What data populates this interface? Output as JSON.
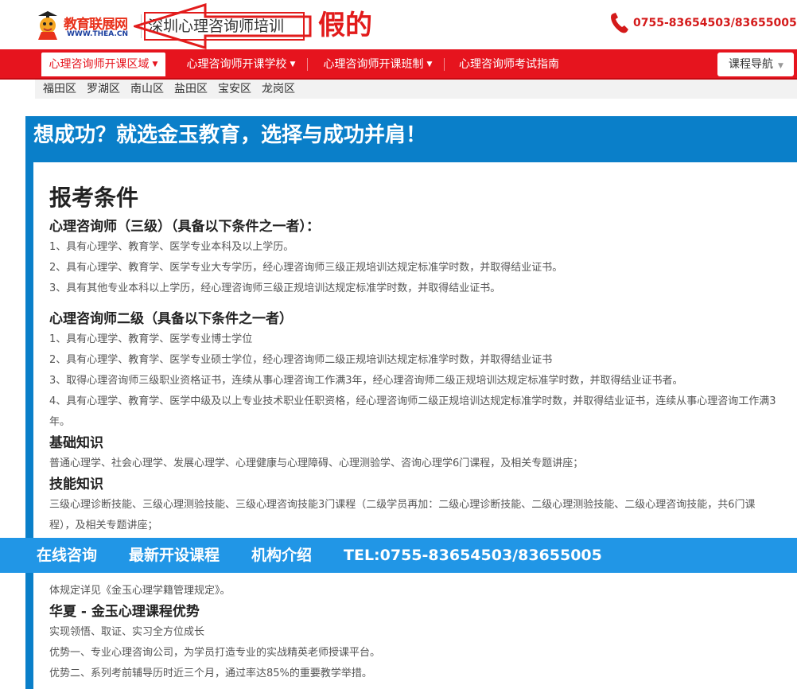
{
  "header": {
    "logo_text": "教育联展网",
    "logo_url": "WWW.THEA.CN",
    "site_title": "深圳心理咨询师培训",
    "annotation_fake": "假的",
    "phone": "0755-83654503/83655005"
  },
  "nav": {
    "items": [
      {
        "label": "心理咨询师开课区域"
      },
      {
        "label": "心理咨询师开课学校"
      },
      {
        "label": "心理咨询师开课班制"
      },
      {
        "label": "心理咨询师考试指南"
      }
    ],
    "course_nav": "课程导航"
  },
  "districts": [
    "福田区",
    "罗湖区",
    "南山区",
    "盐田区",
    "宝安区",
    "龙岗区"
  ],
  "banner": "想成功？就选金玉教育，选择与成功并肩！",
  "content": {
    "title": "报考条件",
    "level3_heading": "心理咨询师（三级）（具备以下条件之一者）：",
    "level3_items": [
      "1、具有心理学、教育学、医学专业本科及以上学历。",
      "2、具有心理学、教育学、医学专业大专学历，经心理咨询师三级正规培训达规定标准学时数，并取得结业证书。",
      "3、具有其他专业本科以上学历，经心理咨询师三级正规培训达规定标准学时数，并取得结业证书。"
    ],
    "level2_heading": "心理咨询师二级（具备以下条件之一者）",
    "level2_items": [
      "1、具有心理学、教育学、医学专业博士学位",
      "2、具有心理学、教育学、医学专业硕士学位，经心理咨询师二级正规培训达规定标准学时数，并取得结业证书",
      "3、取得心理咨询师三级职业资格证书，连续从事心理咨询工作满3年，经心理咨询师二级正规培训达规定标准学时数，并取得结业证书者。",
      "4、具有心理学、教育学、医学中级及以上专业技术职业任职资格，经心理咨询师二级正规培训达规定标准学时数，并取得结业证书，连续从事心理咨询工作满3年。"
    ],
    "basic_heading": "基础知识",
    "basic_text": "普通心理学、社会心理学、发展心理学、心理健康与心理障碍、心理测验学、咨询心理学6门课程，及相关专题讲座；",
    "skill_heading": "技能知识",
    "skill_text": "三级心理诊断技能、三级心理测验技能、三级心理咨询技能3门课程（二级学员再加：二级心理诊断技能、二级心理测验技能、二级心理咨询技能，共6门课程），及相关专题讲座；",
    "rules_text": "体规定详见《金玉心理学籍管理规定》。",
    "adv_heading": "华夏 - 金玉心理课程优势",
    "adv_items": [
      "实现领悟、取证、实习全方位成长",
      "优势一、专业心理咨询公司，为学员打造专业的实战精英老师授课平台。",
      "优势二、系列考前辅导历时近三个月，通过率达85%的重要教学举措。"
    ]
  },
  "float_bar": {
    "items": [
      "在线咨询",
      "最新开设课程",
      "机构介绍",
      "TEL:0755-83654503/83655005"
    ]
  },
  "colors": {
    "nav_red": "#e6141e",
    "banner_blue": "#0a7fc9",
    "float_blue": "#2196e6",
    "annotation_red": "#e21b1b"
  }
}
